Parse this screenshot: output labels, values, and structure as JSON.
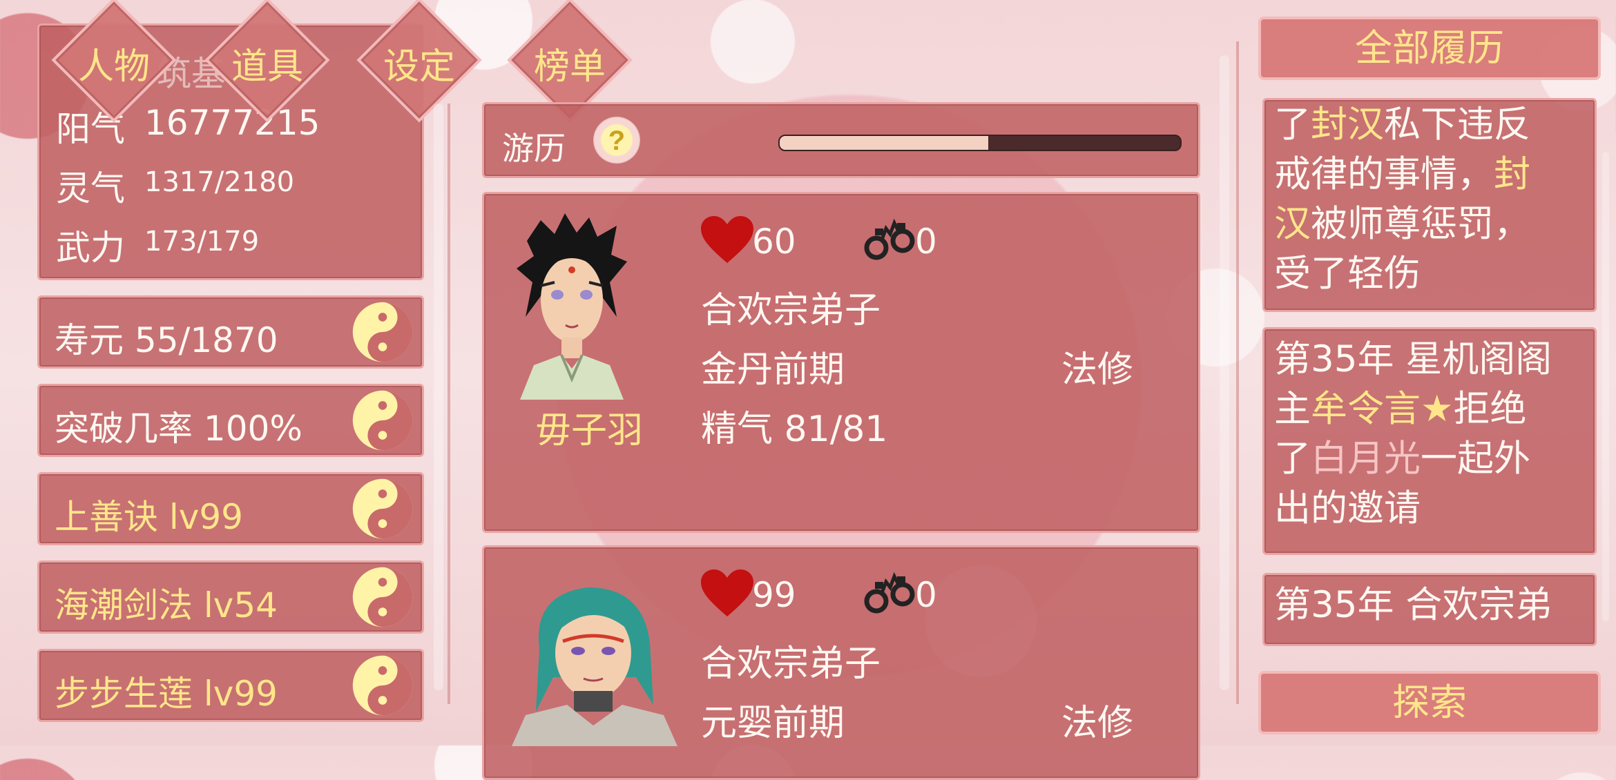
{
  "colors": {
    "gold": "#ffe68a",
    "white": "#fff8f2",
    "panel": "#c06264",
    "heart": "#c41010"
  },
  "tabs": [
    {
      "label": "人物"
    },
    {
      "label": "道具"
    },
    {
      "label": "设定"
    },
    {
      "label": "榜单"
    }
  ],
  "stats": {
    "realm_partial": "筑基",
    "yangqi_label": "阳气",
    "yangqi_value": "16777215",
    "lingqi_label": "灵气",
    "lingqi_value": "1317/2180",
    "wuli_label": "武力",
    "wuli_value": "173/179"
  },
  "attributes": [
    {
      "text": "寿元 55/1870",
      "color": "white",
      "icon": "yin-yang-icon"
    },
    {
      "text": "突破几率 100%",
      "color": "white",
      "icon": "yin-yang-icon"
    },
    {
      "text": "上善诀 lv99",
      "color": "gold",
      "icon": "yin-yang-icon"
    },
    {
      "text": "海潮剑法 lv54",
      "color": "gold",
      "icon": "yin-yang-icon"
    },
    {
      "text": "步步生莲 lv99",
      "color": "gold",
      "icon": "yin-yang-icon"
    }
  ],
  "travel": {
    "label": "游历",
    "help_icon": "question-icon",
    "progress": 0.52
  },
  "characters": [
    {
      "name": "毋子羽",
      "heart": "60",
      "shackle": "0",
      "sect": "合欢宗弟子",
      "realm": "金丹前期",
      "class": "法修",
      "essence": "精气 81/81"
    },
    {
      "name": "",
      "heart": "99",
      "shackle": "0",
      "sect": "合欢宗弟子",
      "realm": "元婴前期",
      "class": "法修",
      "essence": ""
    }
  ],
  "history": {
    "button": "全部履历",
    "entries": [
      [
        {
          "t": "了",
          "c": "w"
        },
        {
          "t": "封汉",
          "c": "g"
        },
        {
          "t": "私下违反",
          "c": "w"
        },
        {
          "t": "\n戒律的事情，",
          "c": "w"
        },
        {
          "t": "封",
          "c": "g"
        },
        {
          "t": "\n汉",
          "c": "g"
        },
        {
          "t": "被师尊惩罚，",
          "c": "w"
        },
        {
          "t": "\n受了轻伤",
          "c": "w"
        }
      ],
      [
        {
          "t": "第35年 星机阁阁",
          "c": "w"
        },
        {
          "t": "\n主",
          "c": "w"
        },
        {
          "t": "牟令言★",
          "c": "g"
        },
        {
          "t": "拒绝",
          "c": "w"
        },
        {
          "t": "\n了",
          "c": "w"
        },
        {
          "t": "白月光",
          "c": "p"
        },
        {
          "t": "一起外",
          "c": "w"
        },
        {
          "t": "\n出的邀请",
          "c": "w"
        }
      ],
      [
        {
          "t": "第35年 合欢宗弟",
          "c": "w"
        }
      ]
    ],
    "explore_button": "探索"
  }
}
